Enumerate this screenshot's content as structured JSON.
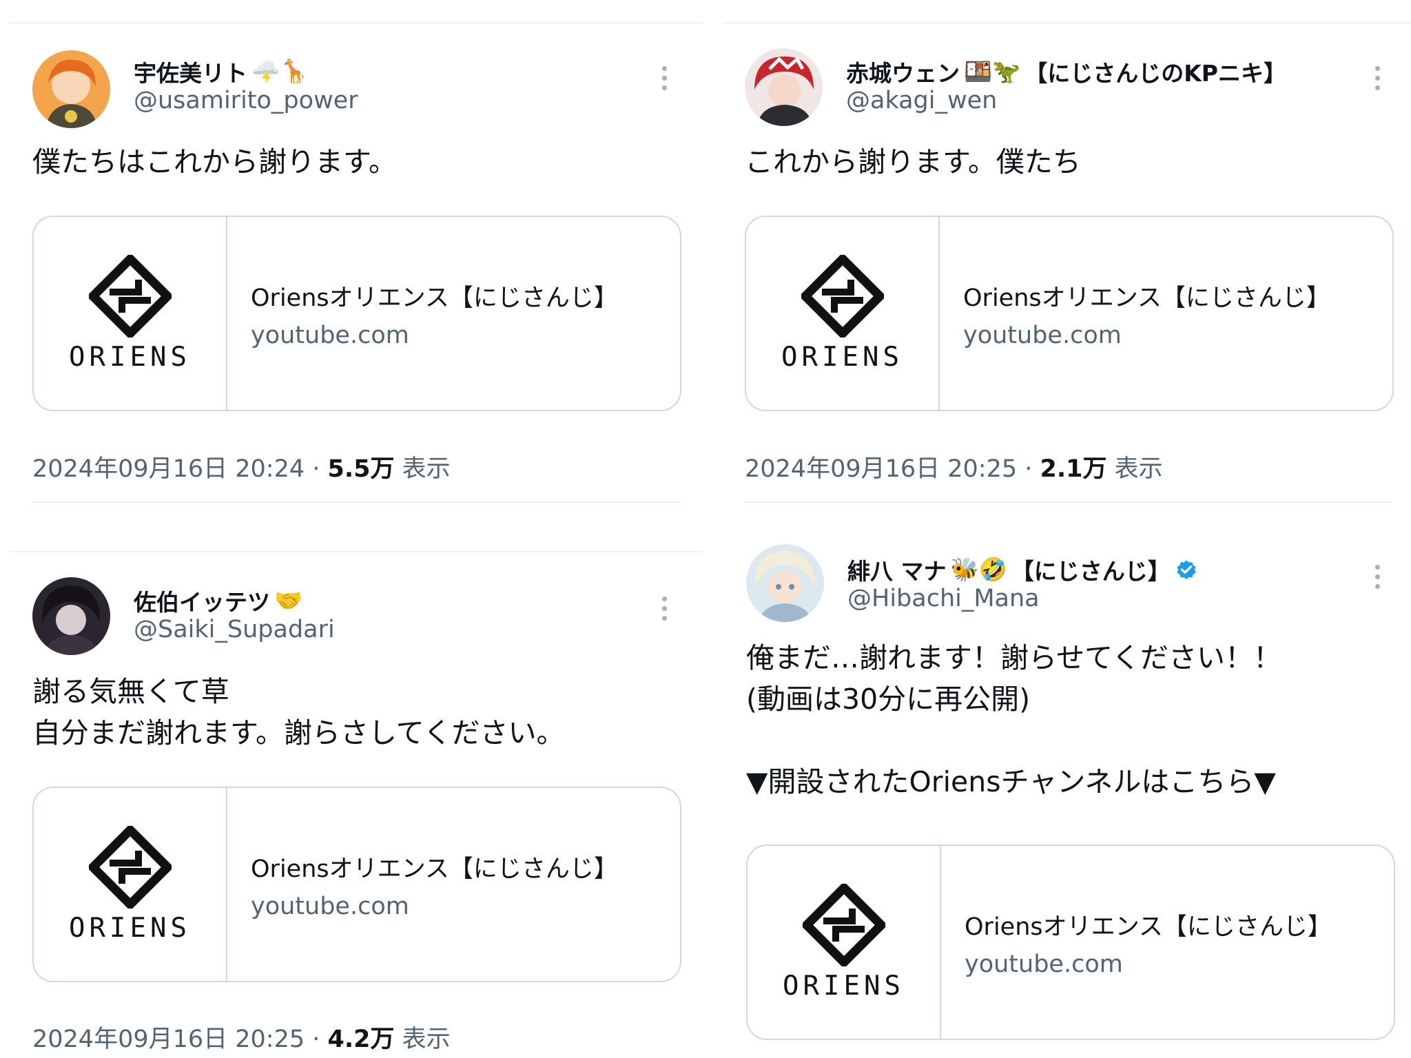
{
  "colors": {
    "text": "#0f1419",
    "secondary": "#536471",
    "border": "#cfd9de",
    "verified": "#1d9bf0"
  },
  "tweets": [
    {
      "name": "宇佐美リト",
      "emoji": "🌩️🦒",
      "handle": "@usamirito_power",
      "text": "僕たちはこれから謝ります。",
      "card": {
        "logo": "ORIENS",
        "title": "Oriensオリエンス【にじさんじ】",
        "domain": "youtube.com"
      },
      "time": "2024年09月16日 20:24",
      "sep": " · ",
      "views": "5.5万",
      "views_label": " 表示"
    },
    {
      "name": "赤城ウェン",
      "emoji": "🍱🦖",
      "tag": "【にじさんじのKPニキ】",
      "handle": "@akagi_wen",
      "text": "これから謝ります。僕たち",
      "card": {
        "logo": "ORIENS",
        "title": "Oriensオリエンス【にじさんじ】",
        "domain": "youtube.com"
      },
      "time": "2024年09月16日 20:25",
      "sep": " · ",
      "views": "2.1万",
      "views_label": " 表示"
    },
    {
      "name": "佐伯イッテツ",
      "emoji": "🤝",
      "handle": "@Saiki_Supadari",
      "text": "謝る気無くて草\n自分まだ謝れます。謝らさしてください。",
      "card": {
        "logo": "ORIENS",
        "title": "Oriensオリエンス【にじさんじ】",
        "domain": "youtube.com"
      },
      "time": "2024年09月16日 20:25",
      "sep": " · ",
      "views": "4.2万",
      "views_label": " 表示"
    },
    {
      "name": "緋八 マナ",
      "emoji": "🐝🤣",
      "tag": "【にじさんじ】",
      "handle": "@Hibachi_Mana",
      "text": "俺まだ…謝れます！謝らせてください！！\n(動画は30分に再公開)\n\n▼開設されたOriensチャンネルはこちら▼",
      "card": {
        "logo": "ORIENS",
        "title": "Oriensオリエンス【にじさんじ】",
        "domain": "youtube.com"
      }
    }
  ]
}
